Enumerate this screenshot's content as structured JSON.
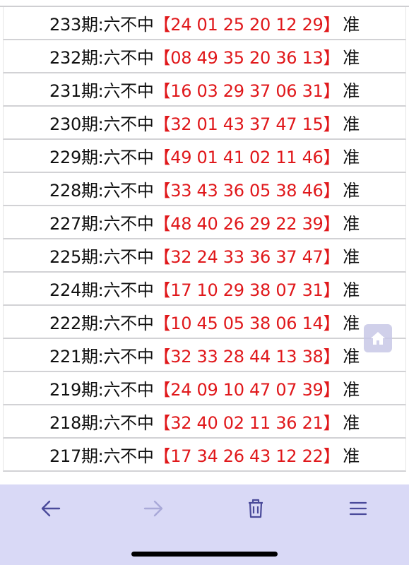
{
  "rows": [
    {
      "issue": "233期:六不中",
      "nums": "【24 01 25 20 12 29】",
      "mark": "准"
    },
    {
      "issue": "232期:六不中",
      "nums": "【08 49 35 20 36 13】",
      "mark": "准"
    },
    {
      "issue": "231期:六不中",
      "nums": "【16 03 29 37 06 31】",
      "mark": "准"
    },
    {
      "issue": "230期:六不中",
      "nums": "【32 01 43 37 47 15】",
      "mark": "准"
    },
    {
      "issue": "229期:六不中",
      "nums": "【49 01 41 02 11 46】",
      "mark": "准"
    },
    {
      "issue": "228期:六不中",
      "nums": "【33 43 36 05 38 46】",
      "mark": "准"
    },
    {
      "issue": "227期:六不中",
      "nums": "【48 40 26 29 22 39】",
      "mark": "准"
    },
    {
      "issue": "225期:六不中",
      "nums": "【32 24 33 36 37 47】",
      "mark": "准"
    },
    {
      "issue": "224期:六不中",
      "nums": "【17 10 29 38 07 31】",
      "mark": "准"
    },
    {
      "issue": "222期:六不中",
      "nums": "【10 45 05 38 06 14】",
      "mark": "准"
    },
    {
      "issue": "221期:六不中",
      "nums": "【32 33 28 44 13 38】",
      "mark": "准"
    },
    {
      "issue": "219期:六不中",
      "nums": "【24 09 10 47 07 39】",
      "mark": "准"
    },
    {
      "issue": "218期:六不中",
      "nums": "【32 40 02 11 36 21】",
      "mark": "准"
    },
    {
      "issue": "217期:六不中",
      "nums": "【17 34 26 43 12 22】",
      "mark": "准"
    }
  ],
  "icons": {
    "home": "home-icon",
    "back": "arrow-left-icon",
    "forward": "arrow-right-icon",
    "delete": "trash-icon",
    "menu": "menu-icon"
  },
  "colors": {
    "numbers": "#e0181b",
    "text": "#111111",
    "toolbar": "#d9d9f6",
    "toolbar_icon": "#4a4a9a",
    "toolbar_icon_disabled": "#a9a9d8"
  }
}
